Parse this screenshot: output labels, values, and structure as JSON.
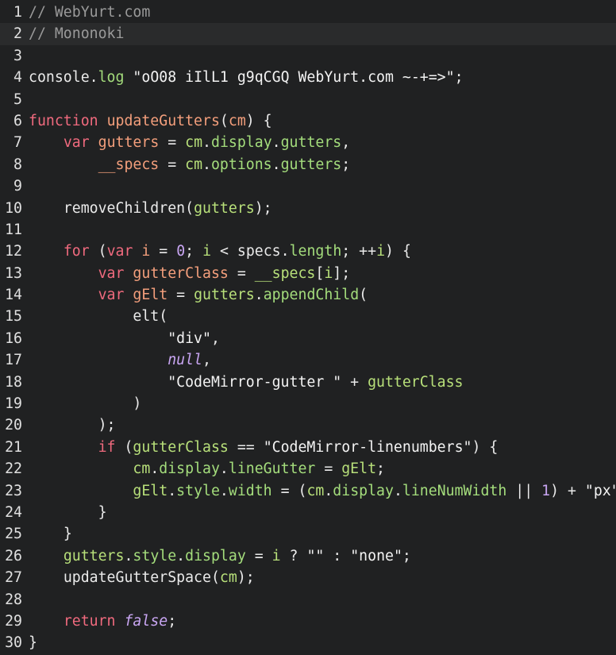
{
  "editor": {
    "lines": [
      {
        "n": "1",
        "tokens": [
          {
            "t": "// WebYurt.com",
            "c": "comment"
          }
        ]
      },
      {
        "n": "2",
        "active": true,
        "tokens": [
          {
            "t": "// Mononoki",
            "c": "comment"
          }
        ]
      },
      {
        "n": "3",
        "tokens": []
      },
      {
        "n": "4",
        "tokens": [
          {
            "t": "console",
            "c": "plain"
          },
          {
            "t": ".",
            "c": "punc"
          },
          {
            "t": "log",
            "c": "prop"
          },
          {
            "t": " ",
            "c": "plain"
          },
          {
            "t": "\"oO08 iIlL1 g9qCGQ WebYurt.com ~-+=>\"",
            "c": "string"
          },
          {
            "t": ";",
            "c": "punc"
          }
        ]
      },
      {
        "n": "5",
        "tokens": []
      },
      {
        "n": "6",
        "tokens": [
          {
            "t": "function",
            "c": "keyword"
          },
          {
            "t": " ",
            "c": "plain"
          },
          {
            "t": "updateGutters",
            "c": "def"
          },
          {
            "t": "(",
            "c": "punc"
          },
          {
            "t": "cm",
            "c": "def"
          },
          {
            "t": ") {",
            "c": "punc"
          }
        ]
      },
      {
        "n": "7",
        "tokens": [
          {
            "t": "    ",
            "c": "plain"
          },
          {
            "t": "var",
            "c": "keyword"
          },
          {
            "t": " ",
            "c": "plain"
          },
          {
            "t": "gutters",
            "c": "def"
          },
          {
            "t": " = ",
            "c": "op"
          },
          {
            "t": "cm",
            "c": "var"
          },
          {
            "t": ".",
            "c": "punc"
          },
          {
            "t": "display",
            "c": "prop"
          },
          {
            "t": ".",
            "c": "punc"
          },
          {
            "t": "gutters",
            "c": "prop"
          },
          {
            "t": ",",
            "c": "punc"
          }
        ]
      },
      {
        "n": "8",
        "tokens": [
          {
            "t": "        ",
            "c": "plain"
          },
          {
            "t": "__specs",
            "c": "def"
          },
          {
            "t": " = ",
            "c": "op"
          },
          {
            "t": "cm",
            "c": "var"
          },
          {
            "t": ".",
            "c": "punc"
          },
          {
            "t": "options",
            "c": "prop"
          },
          {
            "t": ".",
            "c": "punc"
          },
          {
            "t": "gutters",
            "c": "prop"
          },
          {
            "t": ";",
            "c": "punc"
          }
        ]
      },
      {
        "n": "9",
        "tokens": []
      },
      {
        "n": "10",
        "tokens": [
          {
            "t": "    ",
            "c": "plain"
          },
          {
            "t": "removeChildren",
            "c": "plain"
          },
          {
            "t": "(",
            "c": "punc"
          },
          {
            "t": "gutters",
            "c": "var"
          },
          {
            "t": ");",
            "c": "punc"
          }
        ]
      },
      {
        "n": "11",
        "tokens": []
      },
      {
        "n": "12",
        "tokens": [
          {
            "t": "    ",
            "c": "plain"
          },
          {
            "t": "for",
            "c": "keyword"
          },
          {
            "t": " (",
            "c": "punc"
          },
          {
            "t": "var",
            "c": "keyword"
          },
          {
            "t": " ",
            "c": "plain"
          },
          {
            "t": "i",
            "c": "def"
          },
          {
            "t": " = ",
            "c": "op"
          },
          {
            "t": "0",
            "c": "number"
          },
          {
            "t": "; ",
            "c": "punc"
          },
          {
            "t": "i",
            "c": "var"
          },
          {
            "t": " < ",
            "c": "op"
          },
          {
            "t": "specs",
            "c": "plain"
          },
          {
            "t": ".",
            "c": "punc"
          },
          {
            "t": "length",
            "c": "prop"
          },
          {
            "t": "; ++",
            "c": "punc"
          },
          {
            "t": "i",
            "c": "var"
          },
          {
            "t": ") {",
            "c": "punc"
          }
        ]
      },
      {
        "n": "13",
        "tokens": [
          {
            "t": "        ",
            "c": "plain"
          },
          {
            "t": "var",
            "c": "keyword"
          },
          {
            "t": " ",
            "c": "plain"
          },
          {
            "t": "gutterClass",
            "c": "def"
          },
          {
            "t": " = ",
            "c": "op"
          },
          {
            "t": "__specs",
            "c": "var"
          },
          {
            "t": "[",
            "c": "punc"
          },
          {
            "t": "i",
            "c": "var"
          },
          {
            "t": "];",
            "c": "punc"
          }
        ]
      },
      {
        "n": "14",
        "tokens": [
          {
            "t": "        ",
            "c": "plain"
          },
          {
            "t": "var",
            "c": "keyword"
          },
          {
            "t": " ",
            "c": "plain"
          },
          {
            "t": "gElt",
            "c": "def"
          },
          {
            "t": " = ",
            "c": "op"
          },
          {
            "t": "gutters",
            "c": "var"
          },
          {
            "t": ".",
            "c": "punc"
          },
          {
            "t": "appendChild",
            "c": "prop"
          },
          {
            "t": "(",
            "c": "punc"
          }
        ]
      },
      {
        "n": "15",
        "tokens": [
          {
            "t": "            ",
            "c": "plain"
          },
          {
            "t": "elt",
            "c": "plain"
          },
          {
            "t": "(",
            "c": "punc"
          }
        ]
      },
      {
        "n": "16",
        "tokens": [
          {
            "t": "                ",
            "c": "plain"
          },
          {
            "t": "\"div\"",
            "c": "string"
          },
          {
            "t": ",",
            "c": "punc"
          }
        ]
      },
      {
        "n": "17",
        "tokens": [
          {
            "t": "                ",
            "c": "plain"
          },
          {
            "t": "null",
            "c": "atom"
          },
          {
            "t": ",",
            "c": "punc"
          }
        ]
      },
      {
        "n": "18",
        "tokens": [
          {
            "t": "                ",
            "c": "plain"
          },
          {
            "t": "\"CodeMirror-gutter \"",
            "c": "string"
          },
          {
            "t": " + ",
            "c": "op"
          },
          {
            "t": "gutterClass",
            "c": "var"
          }
        ]
      },
      {
        "n": "19",
        "tokens": [
          {
            "t": "            ",
            "c": "plain"
          },
          {
            "t": ")",
            "c": "punc"
          }
        ]
      },
      {
        "n": "20",
        "tokens": [
          {
            "t": "        ",
            "c": "plain"
          },
          {
            "t": ");",
            "c": "punc"
          }
        ]
      },
      {
        "n": "21",
        "tokens": [
          {
            "t": "        ",
            "c": "plain"
          },
          {
            "t": "if",
            "c": "keyword"
          },
          {
            "t": " (",
            "c": "punc"
          },
          {
            "t": "gutterClass",
            "c": "var"
          },
          {
            "t": " == ",
            "c": "op"
          },
          {
            "t": "\"CodeMirror-linenumbers\"",
            "c": "string"
          },
          {
            "t": ") {",
            "c": "punc"
          }
        ]
      },
      {
        "n": "22",
        "tokens": [
          {
            "t": "            ",
            "c": "plain"
          },
          {
            "t": "cm",
            "c": "var"
          },
          {
            "t": ".",
            "c": "punc"
          },
          {
            "t": "display",
            "c": "prop"
          },
          {
            "t": ".",
            "c": "punc"
          },
          {
            "t": "lineGutter",
            "c": "prop"
          },
          {
            "t": " = ",
            "c": "op"
          },
          {
            "t": "gElt",
            "c": "var"
          },
          {
            "t": ";",
            "c": "punc"
          }
        ]
      },
      {
        "n": "23",
        "tokens": [
          {
            "t": "            ",
            "c": "plain"
          },
          {
            "t": "gElt",
            "c": "var"
          },
          {
            "t": ".",
            "c": "punc"
          },
          {
            "t": "style",
            "c": "prop"
          },
          {
            "t": ".",
            "c": "punc"
          },
          {
            "t": "width",
            "c": "prop"
          },
          {
            "t": " = (",
            "c": "op"
          },
          {
            "t": "cm",
            "c": "var"
          },
          {
            "t": ".",
            "c": "punc"
          },
          {
            "t": "display",
            "c": "prop"
          },
          {
            "t": ".",
            "c": "punc"
          },
          {
            "t": "lineNumWidth",
            "c": "prop"
          },
          {
            "t": " || ",
            "c": "op"
          },
          {
            "t": "1",
            "c": "number"
          },
          {
            "t": ") + ",
            "c": "op"
          },
          {
            "t": "\"px\";",
            "c": "string"
          }
        ]
      },
      {
        "n": "24",
        "tokens": [
          {
            "t": "        ",
            "c": "plain"
          },
          {
            "t": "}",
            "c": "punc"
          }
        ]
      },
      {
        "n": "25",
        "tokens": [
          {
            "t": "    ",
            "c": "plain"
          },
          {
            "t": "}",
            "c": "punc"
          }
        ]
      },
      {
        "n": "26",
        "tokens": [
          {
            "t": "    ",
            "c": "plain"
          },
          {
            "t": "gutters",
            "c": "var"
          },
          {
            "t": ".",
            "c": "punc"
          },
          {
            "t": "style",
            "c": "prop"
          },
          {
            "t": ".",
            "c": "punc"
          },
          {
            "t": "display",
            "c": "prop"
          },
          {
            "t": " = ",
            "c": "op"
          },
          {
            "t": "i",
            "c": "var"
          },
          {
            "t": " ? ",
            "c": "op"
          },
          {
            "t": "\"\"",
            "c": "string"
          },
          {
            "t": " : ",
            "c": "op"
          },
          {
            "t": "\"none\"",
            "c": "string"
          },
          {
            "t": ";",
            "c": "punc"
          }
        ]
      },
      {
        "n": "27",
        "tokens": [
          {
            "t": "    ",
            "c": "plain"
          },
          {
            "t": "updateGutterSpace",
            "c": "plain"
          },
          {
            "t": "(",
            "c": "punc"
          },
          {
            "t": "cm",
            "c": "var"
          },
          {
            "t": ");",
            "c": "punc"
          }
        ]
      },
      {
        "n": "28",
        "tokens": []
      },
      {
        "n": "29",
        "tokens": [
          {
            "t": "    ",
            "c": "plain"
          },
          {
            "t": "return",
            "c": "keyword"
          },
          {
            "t": " ",
            "c": "plain"
          },
          {
            "t": "false",
            "c": "atom"
          },
          {
            "t": ";",
            "c": "punc"
          }
        ]
      },
      {
        "n": "30",
        "tokens": [
          {
            "t": "}",
            "c": "punc"
          }
        ]
      }
    ]
  }
}
